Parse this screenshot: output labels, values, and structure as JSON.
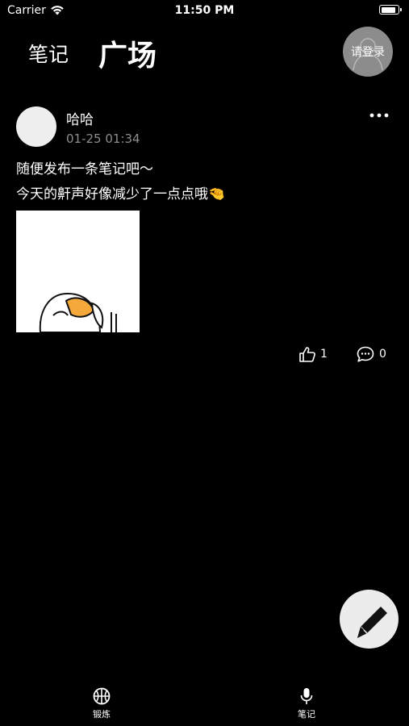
{
  "status_bar": {
    "carrier": "Carrier",
    "time": "11:50 PM",
    "battery_level": 0.9
  },
  "header": {
    "tab_notes": "笔记",
    "tab_square": "广场",
    "login_label": "请登录"
  },
  "post": {
    "author": "哈哈",
    "time": "01-25 01:34",
    "text_line1": "随便发布一条笔记吧～",
    "text_line2": "今天的鼾声好像减少了一点点哦🤏",
    "like_count": "1",
    "comment_count": "0"
  },
  "tab_bar": {
    "items": [
      {
        "label": "锻炼",
        "icon": "basketball-icon"
      },
      {
        "label": "笔记",
        "icon": "microphone-icon"
      }
    ]
  },
  "colors": {
    "background": "#000000",
    "text_primary": "#ffffff",
    "text_secondary": "#8e8e8e",
    "login_button": "#8c8c8c",
    "compose_button": "#ececec"
  }
}
